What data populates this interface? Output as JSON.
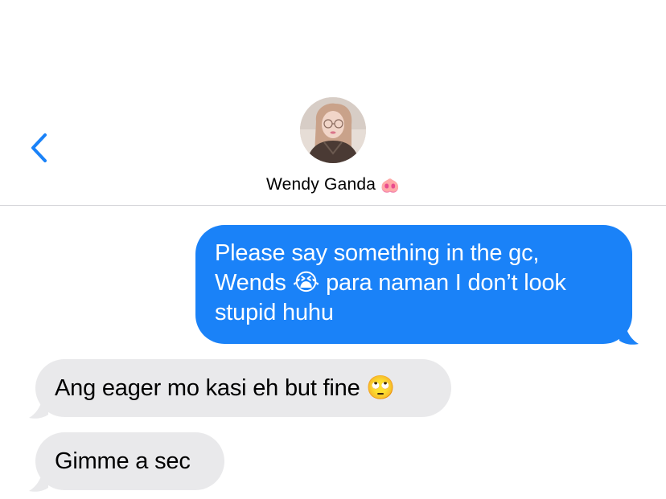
{
  "header": {
    "back_icon": "chevron-left-icon",
    "contact_name": "Wendy Ganda",
    "contact_emoji": "🐽",
    "accent_color": "#1a82f8"
  },
  "messages": [
    {
      "direction": "sent",
      "lines": [
        "Please say something in the gc,",
        "Wends 😭 para naman I don’t look",
        "stupid huhu"
      ]
    },
    {
      "direction": "received",
      "text": "Ang eager mo kasi eh but fine 🙄"
    },
    {
      "direction": "received",
      "text": "Gimme a sec"
    }
  ]
}
